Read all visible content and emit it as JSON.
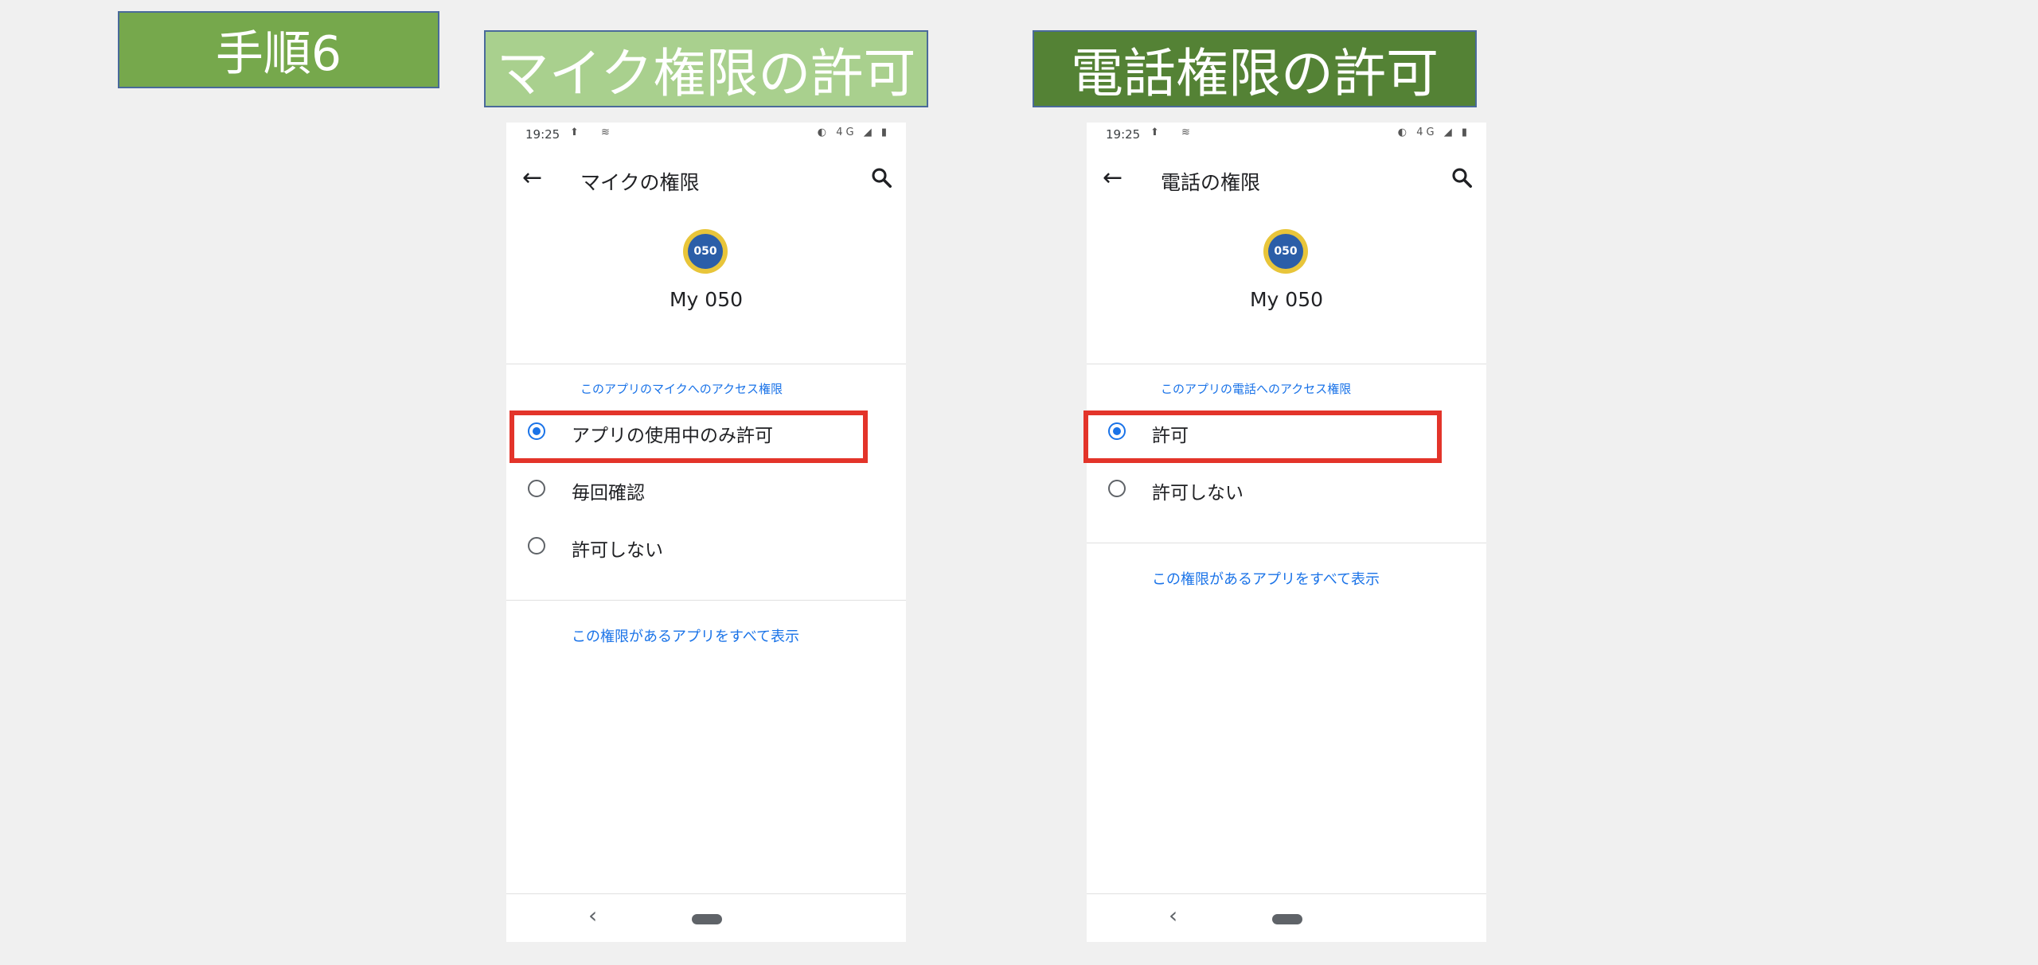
{
  "step_label": "手順6",
  "panels": [
    {
      "title": "マイク権限の許可",
      "status": {
        "time": "19:25",
        "left_icons": "⬆ ≋",
        "right_icons": "◐ 4G ◢ ▮"
      },
      "appbar_title": "マイクの権限",
      "app_icon_text": "050",
      "app_name": "My 050",
      "section_header": "このアプリのマイクへのアクセス権限",
      "options": [
        {
          "label": "アプリの使用中のみ許可",
          "selected": true
        },
        {
          "label": "毎回確認",
          "selected": false
        },
        {
          "label": "許可しない",
          "selected": false
        }
      ],
      "link": "この権限があるアプリをすべて表示"
    },
    {
      "title": "電話権限の許可",
      "status": {
        "time": "19:25",
        "left_icons": "⬆ ≋",
        "right_icons": "◐ 4G ◢ ▮"
      },
      "appbar_title": "電話の権限",
      "app_icon_text": "050",
      "app_name": "My 050",
      "section_header": "このアプリの電話へのアクセス権限",
      "options": [
        {
          "label": "許可",
          "selected": true
        },
        {
          "label": "許可しない",
          "selected": false
        }
      ],
      "link": "この権限があるアプリをすべて表示"
    }
  ],
  "icons": {
    "back": "arrow-back-icon",
    "search": "search-icon",
    "nav_back": "chevron-left-icon",
    "nav_home": "home-pill-icon"
  },
  "colors": {
    "step_box": "#76a84c",
    "mic_title_box": "#a9d08e",
    "phone_title_box": "#548235",
    "highlight": "#e3342a",
    "accent": "#1a73e8"
  }
}
